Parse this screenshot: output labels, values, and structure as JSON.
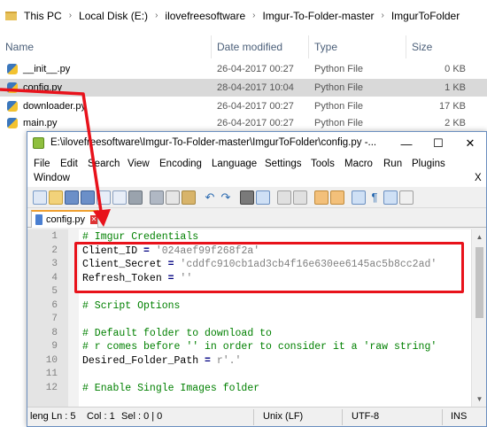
{
  "explorer": {
    "breadcrumb": [
      "This PC",
      "Local Disk (E:)",
      "ilovefreesoftware",
      "Imgur-To-Folder-master",
      "ImgurToFolder"
    ],
    "columns": {
      "name": "Name",
      "date": "Date modified",
      "type": "Type",
      "size": "Size"
    },
    "files": [
      {
        "name": "__init__.py",
        "date": "26-04-2017 00:27",
        "type": "Python File",
        "size": "0 KB",
        "selected": false
      },
      {
        "name": "config.py",
        "date": "28-04-2017 10:04",
        "type": "Python File",
        "size": "1 KB",
        "selected": true
      },
      {
        "name": "downloader.py",
        "date": "26-04-2017 00:27",
        "type": "Python File",
        "size": "17 KB",
        "selected": false
      },
      {
        "name": "main.py",
        "date": "26-04-2017 00:27",
        "type": "Python File",
        "size": "2 KB",
        "selected": false
      }
    ]
  },
  "notepad": {
    "title": "E:\\ilovefreesoftware\\Imgur-To-Folder-master\\ImgurToFolder\\config.py -...",
    "window_buttons": {
      "minimize": "—",
      "maximize": "☐",
      "close": "✕"
    },
    "menu": [
      "File",
      "Edit",
      "Search",
      "View",
      "Encoding",
      "Language",
      "Settings",
      "Tools",
      "Macro",
      "Run",
      "Plugins",
      "Window"
    ],
    "menu_close": "X",
    "tab": {
      "label": "config.py",
      "close": "✕"
    },
    "code": [
      {
        "n": "1",
        "parts": [
          {
            "t": "# Imgur Credentials",
            "c": "comment"
          }
        ]
      },
      {
        "n": "2",
        "parts": [
          {
            "t": "Client_ID ",
            "c": "id"
          },
          {
            "t": "=",
            "c": "op"
          },
          {
            "t": " '024aef99f268f2a'",
            "c": "string"
          }
        ]
      },
      {
        "n": "3",
        "parts": [
          {
            "t": "Client_Secret ",
            "c": "id"
          },
          {
            "t": "=",
            "c": "op"
          },
          {
            "t": " 'cddfc910cb1ad3cb4f16e630ee6145ac5b8cc2ad'",
            "c": "string"
          }
        ]
      },
      {
        "n": "4",
        "parts": [
          {
            "t": "Refresh_Token ",
            "c": "id"
          },
          {
            "t": "=",
            "c": "op"
          },
          {
            "t": " ''",
            "c": "string"
          }
        ]
      },
      {
        "n": "5",
        "parts": []
      },
      {
        "n": "6",
        "parts": [
          {
            "t": "# Script Options",
            "c": "comment"
          }
        ]
      },
      {
        "n": "7",
        "parts": []
      },
      {
        "n": "8",
        "parts": [
          {
            "t": "# Default folder to download to",
            "c": "comment"
          }
        ]
      },
      {
        "n": "9",
        "parts": [
          {
            "t": "# r comes before '' in order to consider it a 'raw string'",
            "c": "comment"
          }
        ]
      },
      {
        "n": "10",
        "parts": [
          {
            "t": "Desired_Folder_Path ",
            "c": "id"
          },
          {
            "t": "=",
            "c": "op"
          },
          {
            "t": " r'.'",
            "c": "string"
          }
        ]
      },
      {
        "n": "11",
        "parts": []
      },
      {
        "n": "12",
        "parts": [
          {
            "t": "# Enable Single Images folder",
            "c": "comment"
          }
        ]
      }
    ],
    "status": {
      "length": "leng",
      "ln": "Ln : 5",
      "col": "Col : 1",
      "sel": "Sel : 0 | 0",
      "eol": "Unix (LF)",
      "encoding": "UTF-8",
      "mode": "INS"
    }
  },
  "colors": {
    "annotation": "#e8121b",
    "comment": "#008000",
    "string": "#808080"
  }
}
